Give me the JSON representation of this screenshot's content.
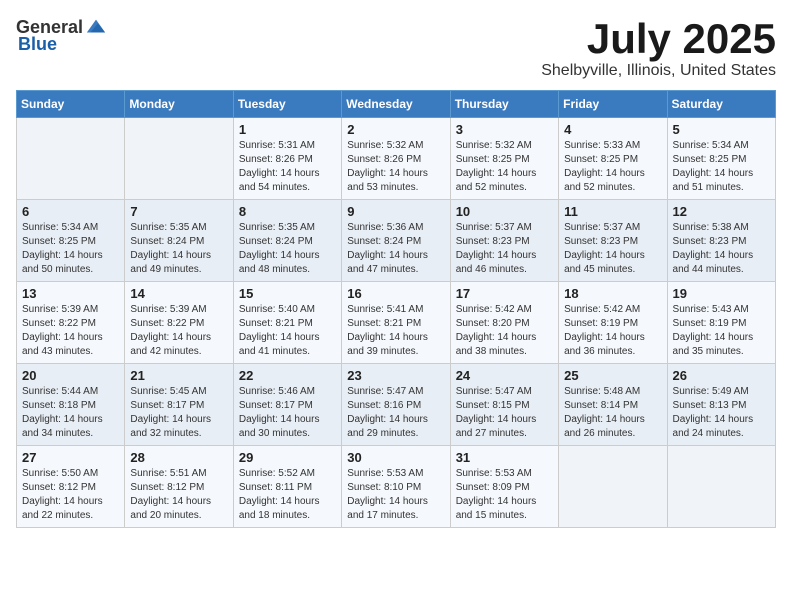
{
  "header": {
    "logo_general": "General",
    "logo_blue": "Blue",
    "month_title": "July 2025",
    "location": "Shelbyville, Illinois, United States"
  },
  "weekdays": [
    "Sunday",
    "Monday",
    "Tuesday",
    "Wednesday",
    "Thursday",
    "Friday",
    "Saturday"
  ],
  "weeks": [
    [
      {
        "day": "",
        "sunrise": "",
        "sunset": "",
        "daylight": ""
      },
      {
        "day": "",
        "sunrise": "",
        "sunset": "",
        "daylight": ""
      },
      {
        "day": "1",
        "sunrise": "Sunrise: 5:31 AM",
        "sunset": "Sunset: 8:26 PM",
        "daylight": "Daylight: 14 hours and 54 minutes."
      },
      {
        "day": "2",
        "sunrise": "Sunrise: 5:32 AM",
        "sunset": "Sunset: 8:26 PM",
        "daylight": "Daylight: 14 hours and 53 minutes."
      },
      {
        "day": "3",
        "sunrise": "Sunrise: 5:32 AM",
        "sunset": "Sunset: 8:25 PM",
        "daylight": "Daylight: 14 hours and 52 minutes."
      },
      {
        "day": "4",
        "sunrise": "Sunrise: 5:33 AM",
        "sunset": "Sunset: 8:25 PM",
        "daylight": "Daylight: 14 hours and 52 minutes."
      },
      {
        "day": "5",
        "sunrise": "Sunrise: 5:34 AM",
        "sunset": "Sunset: 8:25 PM",
        "daylight": "Daylight: 14 hours and 51 minutes."
      }
    ],
    [
      {
        "day": "6",
        "sunrise": "Sunrise: 5:34 AM",
        "sunset": "Sunset: 8:25 PM",
        "daylight": "Daylight: 14 hours and 50 minutes."
      },
      {
        "day": "7",
        "sunrise": "Sunrise: 5:35 AM",
        "sunset": "Sunset: 8:24 PM",
        "daylight": "Daylight: 14 hours and 49 minutes."
      },
      {
        "day": "8",
        "sunrise": "Sunrise: 5:35 AM",
        "sunset": "Sunset: 8:24 PM",
        "daylight": "Daylight: 14 hours and 48 minutes."
      },
      {
        "day": "9",
        "sunrise": "Sunrise: 5:36 AM",
        "sunset": "Sunset: 8:24 PM",
        "daylight": "Daylight: 14 hours and 47 minutes."
      },
      {
        "day": "10",
        "sunrise": "Sunrise: 5:37 AM",
        "sunset": "Sunset: 8:23 PM",
        "daylight": "Daylight: 14 hours and 46 minutes."
      },
      {
        "day": "11",
        "sunrise": "Sunrise: 5:37 AM",
        "sunset": "Sunset: 8:23 PM",
        "daylight": "Daylight: 14 hours and 45 minutes."
      },
      {
        "day": "12",
        "sunrise": "Sunrise: 5:38 AM",
        "sunset": "Sunset: 8:23 PM",
        "daylight": "Daylight: 14 hours and 44 minutes."
      }
    ],
    [
      {
        "day": "13",
        "sunrise": "Sunrise: 5:39 AM",
        "sunset": "Sunset: 8:22 PM",
        "daylight": "Daylight: 14 hours and 43 minutes."
      },
      {
        "day": "14",
        "sunrise": "Sunrise: 5:39 AM",
        "sunset": "Sunset: 8:22 PM",
        "daylight": "Daylight: 14 hours and 42 minutes."
      },
      {
        "day": "15",
        "sunrise": "Sunrise: 5:40 AM",
        "sunset": "Sunset: 8:21 PM",
        "daylight": "Daylight: 14 hours and 41 minutes."
      },
      {
        "day": "16",
        "sunrise": "Sunrise: 5:41 AM",
        "sunset": "Sunset: 8:21 PM",
        "daylight": "Daylight: 14 hours and 39 minutes."
      },
      {
        "day": "17",
        "sunrise": "Sunrise: 5:42 AM",
        "sunset": "Sunset: 8:20 PM",
        "daylight": "Daylight: 14 hours and 38 minutes."
      },
      {
        "day": "18",
        "sunrise": "Sunrise: 5:42 AM",
        "sunset": "Sunset: 8:19 PM",
        "daylight": "Daylight: 14 hours and 36 minutes."
      },
      {
        "day": "19",
        "sunrise": "Sunrise: 5:43 AM",
        "sunset": "Sunset: 8:19 PM",
        "daylight": "Daylight: 14 hours and 35 minutes."
      }
    ],
    [
      {
        "day": "20",
        "sunrise": "Sunrise: 5:44 AM",
        "sunset": "Sunset: 8:18 PM",
        "daylight": "Daylight: 14 hours and 34 minutes."
      },
      {
        "day": "21",
        "sunrise": "Sunrise: 5:45 AM",
        "sunset": "Sunset: 8:17 PM",
        "daylight": "Daylight: 14 hours and 32 minutes."
      },
      {
        "day": "22",
        "sunrise": "Sunrise: 5:46 AM",
        "sunset": "Sunset: 8:17 PM",
        "daylight": "Daylight: 14 hours and 30 minutes."
      },
      {
        "day": "23",
        "sunrise": "Sunrise: 5:47 AM",
        "sunset": "Sunset: 8:16 PM",
        "daylight": "Daylight: 14 hours and 29 minutes."
      },
      {
        "day": "24",
        "sunrise": "Sunrise: 5:47 AM",
        "sunset": "Sunset: 8:15 PM",
        "daylight": "Daylight: 14 hours and 27 minutes."
      },
      {
        "day": "25",
        "sunrise": "Sunrise: 5:48 AM",
        "sunset": "Sunset: 8:14 PM",
        "daylight": "Daylight: 14 hours and 26 minutes."
      },
      {
        "day": "26",
        "sunrise": "Sunrise: 5:49 AM",
        "sunset": "Sunset: 8:13 PM",
        "daylight": "Daylight: 14 hours and 24 minutes."
      }
    ],
    [
      {
        "day": "27",
        "sunrise": "Sunrise: 5:50 AM",
        "sunset": "Sunset: 8:12 PM",
        "daylight": "Daylight: 14 hours and 22 minutes."
      },
      {
        "day": "28",
        "sunrise": "Sunrise: 5:51 AM",
        "sunset": "Sunset: 8:12 PM",
        "daylight": "Daylight: 14 hours and 20 minutes."
      },
      {
        "day": "29",
        "sunrise": "Sunrise: 5:52 AM",
        "sunset": "Sunset: 8:11 PM",
        "daylight": "Daylight: 14 hours and 18 minutes."
      },
      {
        "day": "30",
        "sunrise": "Sunrise: 5:53 AM",
        "sunset": "Sunset: 8:10 PM",
        "daylight": "Daylight: 14 hours and 17 minutes."
      },
      {
        "day": "31",
        "sunrise": "Sunrise: 5:53 AM",
        "sunset": "Sunset: 8:09 PM",
        "daylight": "Daylight: 14 hours and 15 minutes."
      },
      {
        "day": "",
        "sunrise": "",
        "sunset": "",
        "daylight": ""
      },
      {
        "day": "",
        "sunrise": "",
        "sunset": "",
        "daylight": ""
      }
    ]
  ]
}
